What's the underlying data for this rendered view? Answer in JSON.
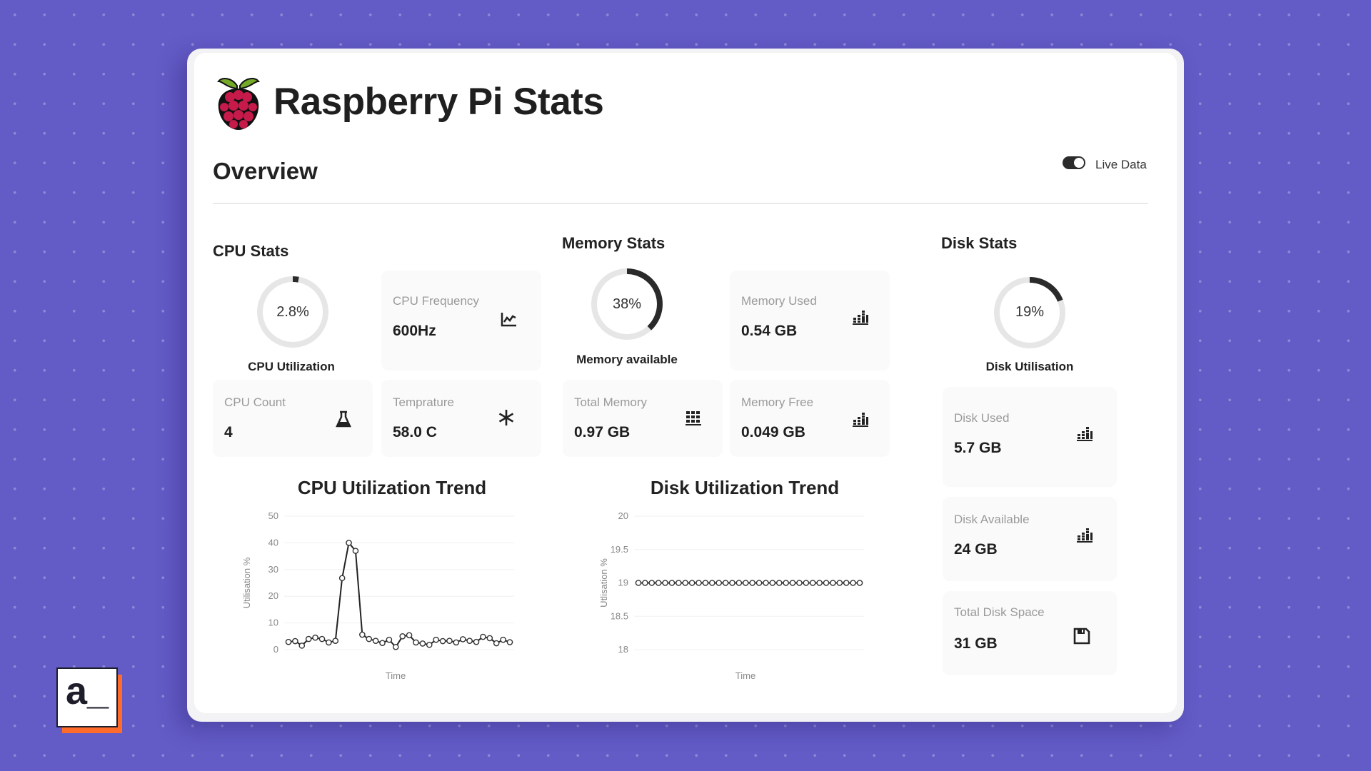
{
  "header": {
    "title": "Raspberry Pi Stats",
    "logo_icon": "raspberry-pi-logo",
    "section": "Overview",
    "live_toggle": {
      "label": "Live Data",
      "checked": true
    }
  },
  "cpu": {
    "title": "CPU Stats",
    "gauge": {
      "value_text": "2.8%",
      "percent": 2.8,
      "caption": "CPU Utilization"
    },
    "cards": [
      {
        "label": "CPU Frequency",
        "value": "600Hz",
        "icon": "line-chart-icon"
      },
      {
        "label": "CPU Count",
        "value": "4",
        "icon": "flask-icon"
      },
      {
        "label": "Temprature",
        "value": "58.0 C",
        "icon": "asterisk-icon"
      }
    ]
  },
  "memory": {
    "title": "Memory Stats",
    "gauge": {
      "value_text": "38%",
      "percent": 38,
      "caption": "Memory available"
    },
    "cards": [
      {
        "label": "Memory Used",
        "value": "0.54 GB",
        "icon": "bar-chart-icon"
      },
      {
        "label": "Total Memory",
        "value": "0.97 GB",
        "icon": "bar-chart-icon"
      },
      {
        "label": "Memory Free",
        "value": "0.049 GB",
        "icon": "bar-chart-icon"
      }
    ]
  },
  "disk": {
    "title": "Disk Stats",
    "gauge": {
      "value_text": "19%",
      "percent": 19,
      "caption": "Disk Utilisation"
    },
    "cards": [
      {
        "label": "Disk Used",
        "value": "5.7 GB",
        "icon": "bar-chart-icon"
      },
      {
        "label": "Disk Available",
        "value": "24 GB",
        "icon": "bar-chart-icon"
      },
      {
        "label": "Total Disk Space",
        "value": "31 GB",
        "icon": "floppy-disk-icon"
      }
    ]
  },
  "chart_data": [
    {
      "type": "line",
      "title": "CPU Utilization Trend",
      "xlabel": "Time",
      "ylabel": "Utilisation %",
      "ylim": [
        0,
        50
      ],
      "yticks": [
        "0",
        "10",
        "20",
        "30",
        "40",
        "50"
      ],
      "grid": true,
      "series": [
        {
          "name": "CPU Utilization",
          "values": [
            2.9,
            3.2,
            1.5,
            4.0,
            4.5,
            4.0,
            2.7,
            3.3,
            26.8,
            40.0,
            37.0,
            5.6,
            4.0,
            3.3,
            2.5,
            3.7,
            1.0,
            5.0,
            5.4,
            2.7,
            2.3,
            1.8,
            3.7,
            3.2,
            3.3,
            2.7,
            3.9,
            3.3,
            2.9,
            4.8,
            4.3,
            2.4,
            3.7,
            2.8
          ]
        }
      ]
    },
    {
      "type": "line",
      "title": "Disk Utilization Trend",
      "xlabel": "Time",
      "ylabel": "Utlisation %",
      "ylim": [
        18,
        20
      ],
      "yticks": [
        "18",
        "18.5",
        "19",
        "19.5",
        "20"
      ],
      "grid": true,
      "series": [
        {
          "name": "Disk Utilization",
          "values": [
            19,
            19,
            19,
            19,
            19,
            19,
            19,
            19,
            19,
            19,
            19,
            19,
            19,
            19,
            19,
            19,
            19,
            19,
            19,
            19,
            19,
            19,
            19,
            19,
            19,
            19,
            19,
            19,
            19,
            19,
            19,
            19,
            19,
            19
          ]
        }
      ]
    }
  ],
  "branding": {
    "text": "a_",
    "accent": "#ff6b2b"
  },
  "colors": {
    "background": "#635bc6",
    "gauge_track": "#e6e6e6",
    "gauge_fill": "#2a2a2a",
    "line": "#222222"
  }
}
